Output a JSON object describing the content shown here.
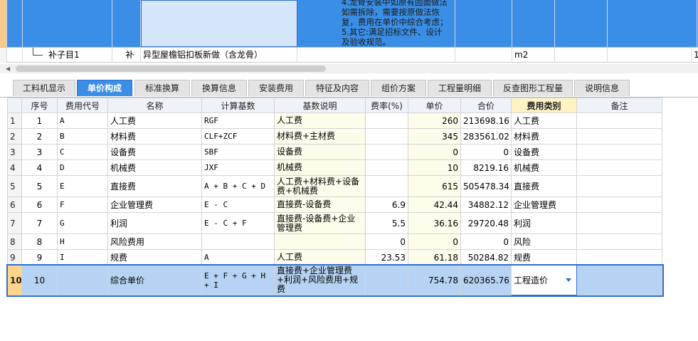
{
  "top": {
    "description_lines": [
      "4.龙骨安装中如原有固面做法",
      "如需拆除，需要按原做法恢",
      "复，费用在单价中综合考虑；",
      "5.其它:满足招标文件、设计",
      "及验收规范。"
    ],
    "sub_row": {
      "name": "补子目1",
      "type": "补",
      "desc": "异型屋檐铝扣板新做（含龙骨）",
      "unit": "m2",
      "qty": "1"
    }
  },
  "tabs": [
    "工料机显示",
    "单价构成",
    "标准换算",
    "换算信息",
    "安装费用",
    "特征及内容",
    "组价方案",
    "工程量明细",
    "反查图形工程量",
    "说明信息"
  ],
  "active_tab": "单价构成",
  "columns": [
    "序号",
    "费用代号",
    "名称",
    "计算基数",
    "基数说明",
    "费率(%)",
    "单价",
    "合价",
    "费用类别",
    "备注"
  ],
  "rows": [
    {
      "rn": "1",
      "seq": "1",
      "code": "A",
      "name": "人工费",
      "base": "RGF",
      "base_desc": "人工费",
      "rate": "",
      "price": "260",
      "total": "213698.16",
      "category": "人工费",
      "note": ""
    },
    {
      "rn": "2",
      "seq": "2",
      "code": "B",
      "name": "材料费",
      "base": "CLF+ZCF",
      "base_desc": "材料费+主材费",
      "rate": "",
      "price": "345",
      "total": "283561.02",
      "category": "材料费",
      "note": ""
    },
    {
      "rn": "3",
      "seq": "3",
      "code": "C",
      "name": "设备费",
      "base": "SBF",
      "base_desc": "设备费",
      "rate": "",
      "price": "0",
      "total": "0",
      "category": "设备费",
      "note": ""
    },
    {
      "rn": "4",
      "seq": "4",
      "code": "D",
      "name": "机械费",
      "base": "JXF",
      "base_desc": "机械费",
      "rate": "",
      "price": "10",
      "total": "8219.16",
      "category": "机械费",
      "note": ""
    },
    {
      "rn": "5",
      "seq": "5",
      "code": "E",
      "name": "直接费",
      "base": "A + B + C + D",
      "base_desc": "人工费+材料费+设备费+机械费",
      "rate": "",
      "price": "615",
      "total": "505478.34",
      "category": "直接费",
      "note": ""
    },
    {
      "rn": "6",
      "seq": "6",
      "code": "F",
      "name": "企业管理费",
      "base": "E - C",
      "base_desc": "直接费-设备费",
      "rate": "6.9",
      "price": "42.44",
      "total": "34882.12",
      "category": "企业管理费",
      "note": ""
    },
    {
      "rn": "7",
      "seq": "7",
      "code": "G",
      "name": "利润",
      "base": "E - C + F",
      "base_desc": "直接费-设备费+企业管理费",
      "rate": "5.5",
      "price": "36.16",
      "total": "29720.48",
      "category": "利润",
      "note": ""
    },
    {
      "rn": "8",
      "seq": "8",
      "code": "H",
      "name": "风险费用",
      "base": "",
      "base_desc": "",
      "rate": "0",
      "price": "0",
      "total": "0",
      "category": "风险",
      "note": ""
    },
    {
      "rn": "9",
      "seq": "9",
      "code": "I",
      "name": "规费",
      "base": "A",
      "base_desc": "人工费",
      "rate": "23.53",
      "price": "61.18",
      "total": "50284.82",
      "category": "规费",
      "note": ""
    },
    {
      "rn": "10",
      "seq": "10",
      "code": "",
      "name": "综合单价",
      "base": "E + F + G + H + I",
      "base_desc": "直接费+企业管理费+利润+风险费用+规费",
      "rate": "",
      "price": "754.78",
      "total": "620365.76",
      "category": "工程造价",
      "note": ""
    }
  ]
}
